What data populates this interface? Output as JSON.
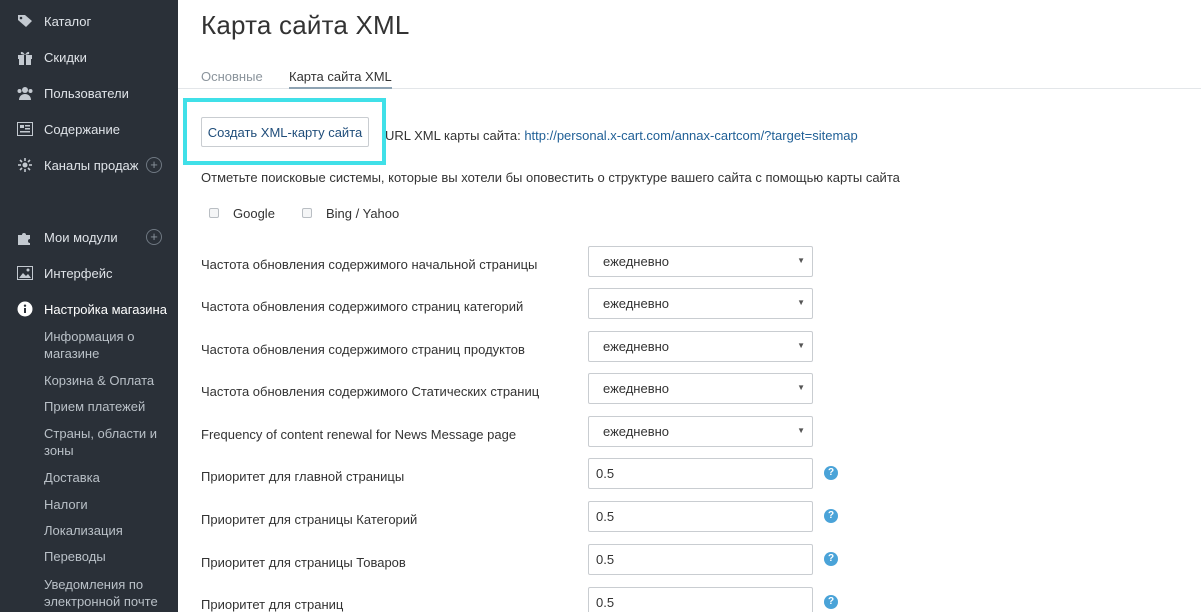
{
  "sidebar": {
    "items": [
      {
        "label": "Каталог",
        "icon": "tag-icon"
      },
      {
        "label": "Скидки",
        "icon": "gift-icon"
      },
      {
        "label": "Пользователи",
        "icon": "users-icon"
      },
      {
        "label": "Содержание",
        "icon": "content-icon"
      },
      {
        "label": "Каналы продаж",
        "icon": "channels-icon"
      },
      {
        "label": "Мои модули",
        "icon": "puzzle-icon"
      },
      {
        "label": "Интерфейс",
        "icon": "image-icon"
      },
      {
        "label": "Настройка магазина",
        "icon": "info-icon"
      }
    ],
    "subitems": [
      "Информация о магазине",
      "Корзина & Оплата",
      "Прием платежей",
      "Страны, области и зоны",
      "Доставка",
      "Налоги",
      "Локализация",
      "Переводы",
      "Уведомления по электронной почте"
    ],
    "plus": "+"
  },
  "page": {
    "title": "Карта сайта XML",
    "tabs": [
      "Основные",
      "Карта сайта XML"
    ]
  },
  "generate": {
    "button_label": "Создать XML-карту сайта",
    "url_prefix": "URL XML карты сайта: ",
    "url": "http://personal.x-cart.com/annax-cartcom/?target=sitemap"
  },
  "notify": {
    "text": "Отметьте поисковые системы, которые вы хотели бы оповестить о структуре вашего сайта с помощью карты сайта",
    "engines": [
      "Google",
      "Bing / Yahoo"
    ]
  },
  "frequency_rows": [
    {
      "label": "Частота обновления содержимого начальной страницы",
      "value": "ежедневно"
    },
    {
      "label": "Частота обновления содержимого страниц категорий",
      "value": "ежедневно"
    },
    {
      "label": "Частота обновления содержимого страниц продуктов",
      "value": "ежедневно"
    },
    {
      "label": "Частота обновления содержимого Статических страниц",
      "value": "ежедневно"
    },
    {
      "label": "Frequency of content renewal for News Message page",
      "value": "ежедневно"
    }
  ],
  "priority_rows": [
    {
      "label": "Приоритет для главной страницы",
      "value": "0.5"
    },
    {
      "label": "Приоритет для страницы Категорий",
      "value": "0.5"
    },
    {
      "label": "Приоритет для страницы Товаров",
      "value": "0.5"
    },
    {
      "label": "Приоритет для страниц",
      "value": "0.5"
    }
  ],
  "glyphs": {
    "select_arrow": "▼",
    "help": "?"
  },
  "colors": {
    "sidebar_bg": "#2a3038",
    "highlight": "#40e0e8",
    "link": "#1f5f96",
    "help_icon": "#4aa3d8"
  }
}
